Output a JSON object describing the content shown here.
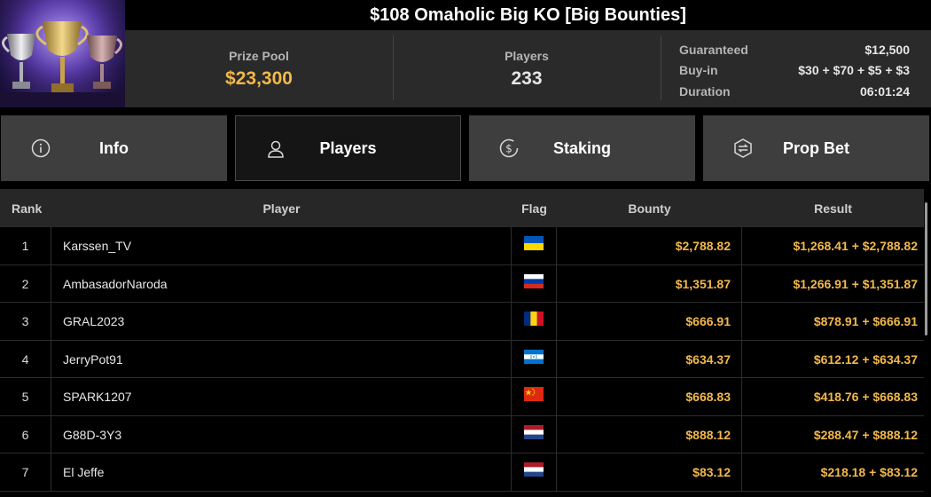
{
  "header": {
    "title": "$108 Omaholic Big KO [Big Bounties]",
    "prize_pool": {
      "label": "Prize Pool",
      "value": "$23,300"
    },
    "players": {
      "label": "Players",
      "value": "233"
    },
    "details": [
      {
        "label": "Guaranteed",
        "value": "$12,500"
      },
      {
        "label": "Buy-in",
        "value": "$30 + $70 + $5 + $3"
      },
      {
        "label": "Duration",
        "value": "06:01:24"
      }
    ]
  },
  "tabs": [
    {
      "label": "Info",
      "icon": "info-icon",
      "active": false
    },
    {
      "label": "Players",
      "icon": "user-icon",
      "active": true
    },
    {
      "label": "Staking",
      "icon": "dollar-coin-icon",
      "active": false
    },
    {
      "label": "Prop Bet",
      "icon": "prop-bet-icon",
      "active": false
    }
  ],
  "table": {
    "columns": {
      "rank": "Rank",
      "player": "Player",
      "flag": "Flag",
      "bounty": "Bounty",
      "result": "Result"
    },
    "rows": [
      {
        "rank": "1",
        "player": "Karssen_TV",
        "flag": "ukraine",
        "bounty": "$2,788.82",
        "result": "$1,268.41 + $2,788.82"
      },
      {
        "rank": "2",
        "player": "AmbasadorNaroda",
        "flag": "russia",
        "bounty": "$1,351.87",
        "result": "$1,266.91 + $1,351.87"
      },
      {
        "rank": "3",
        "player": "GRAL2023",
        "flag": "romania",
        "bounty": "$666.91",
        "result": "$878.91 + $666.91"
      },
      {
        "rank": "4",
        "player": "JerryPot91",
        "flag": "honduras",
        "bounty": "$634.37",
        "result": "$612.12 + $634.37"
      },
      {
        "rank": "5",
        "player": "SPARK1207",
        "flag": "china",
        "bounty": "$668.83",
        "result": "$418.76 + $668.83"
      },
      {
        "rank": "6",
        "player": "G88D-3Y3",
        "flag": "netherlands",
        "bounty": "$888.12",
        "result": "$288.47 + $888.12"
      },
      {
        "rank": "7",
        "player": "El Jeffe",
        "flag": "netherlands",
        "bounty": "$83.12",
        "result": "$218.18 + $83.12"
      }
    ]
  },
  "colors": {
    "accent_gold": "#f2b84b",
    "panel": "#2a2a2a",
    "tab": "#3e3e3e",
    "tab_active": "#151515"
  }
}
